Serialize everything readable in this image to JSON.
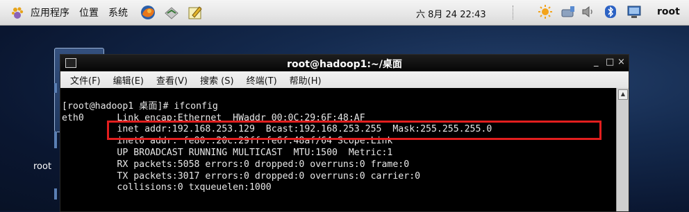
{
  "panel": {
    "menus": [
      "应用程序",
      "位置",
      "系统"
    ],
    "clock": "六 8月 24 22:43",
    "user": "root"
  },
  "desktop": {
    "icon_label": "root"
  },
  "window": {
    "title": "root@hadoop1:~/桌面",
    "controls": {
      "minimize": "_",
      "maximize": "□",
      "close": "×"
    },
    "menu": [
      "文件(F)",
      "编辑(E)",
      "查看(V)",
      "搜索 (S)",
      "终端(T)",
      "帮助(H)"
    ]
  },
  "terminal": {
    "lines": [
      "[root@hadoop1 桌面]# ifconfig",
      "eth0      Link encap:Ethernet  HWaddr 00:0C:29:6F:48:AF",
      "          inet addr:192.168.253.129  Bcast:192.168.253.255  Mask:255.255.255.0",
      "          inet6 addr: fe80::20c:29ff:fe6f:48af/64 Scope:Link",
      "          UP BROADCAST RUNNING MULTICAST  MTU:1500  Metric:1",
      "          RX packets:5058 errors:0 dropped:0 overruns:0 frame:0",
      "          TX packets:3017 errors:0 dropped:0 overruns:0 carrier:0",
      "          collisions:0 txqueuelen:1000"
    ]
  },
  "colors": {
    "highlight_box": "#e21e1e",
    "terminal_bg": "#000000",
    "terminal_fg": "#e8e8e8"
  },
  "icons": [
    "gnome-foot-icon",
    "firefox-icon",
    "email-icon",
    "text-editor-icon",
    "weather-icon",
    "network-icon",
    "volume-icon",
    "bluetooth-icon",
    "display-icon"
  ]
}
